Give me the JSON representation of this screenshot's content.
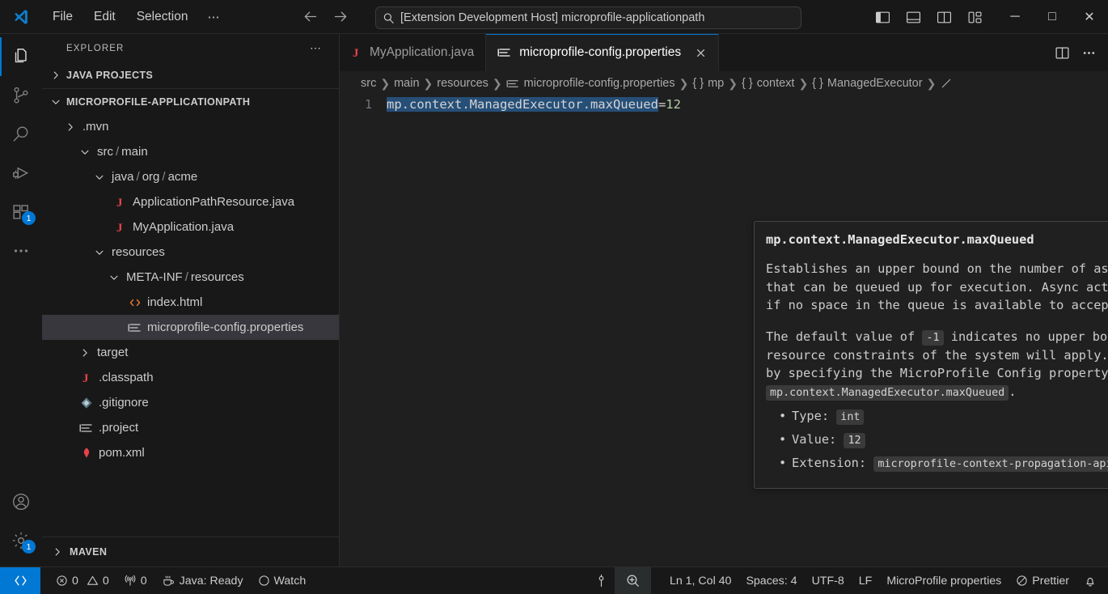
{
  "titlebar": {
    "menus": [
      "File",
      "Edit",
      "Selection",
      "⋯"
    ],
    "back_icon": "arrow-left-icon",
    "forward_icon": "arrow-right-icon",
    "command_center": {
      "icon": "search-icon",
      "text": "[Extension Development Host] microprofile-applicationpath"
    },
    "layout_buttons": [
      {
        "name": "toggle-primary-sidebar",
        "icon": "layout-sidebar-left-icon"
      },
      {
        "name": "toggle-panel",
        "icon": "layout-panel-icon"
      },
      {
        "name": "toggle-secondary-sidebar",
        "icon": "layout-sidebar-right-icon"
      },
      {
        "name": "customize-layout",
        "icon": "layout-customize-icon"
      }
    ],
    "window_buttons": [
      {
        "name": "minimize-button",
        "glyph": "─"
      },
      {
        "name": "maximize-button",
        "glyph": "□"
      },
      {
        "name": "close-button",
        "glyph": "✕"
      }
    ]
  },
  "activitybar": {
    "items": [
      {
        "name": "explorer",
        "icon": "files-icon",
        "active": true,
        "badge": ""
      },
      {
        "name": "source-control",
        "icon": "source-control-icon",
        "active": false,
        "badge": ""
      },
      {
        "name": "search",
        "icon": "search-icon",
        "active": false,
        "badge": ""
      },
      {
        "name": "run-and-debug",
        "icon": "debug-icon",
        "active": false,
        "badge": ""
      },
      {
        "name": "extensions",
        "icon": "extensions-icon",
        "active": false,
        "badge": "1"
      },
      {
        "name": "additional-views",
        "icon": "ellipsis-icon",
        "active": false,
        "badge": ""
      }
    ],
    "bottom_items": [
      {
        "name": "accounts",
        "icon": "account-icon",
        "badge": ""
      },
      {
        "name": "manage-settings",
        "icon": "gear-icon",
        "badge": "1"
      }
    ]
  },
  "sidebar": {
    "title": "EXPLORER",
    "more_actions": "⋯",
    "sections": [
      {
        "label": "JAVA PROJECTS",
        "expanded": false,
        "chevron": "chevron-right-icon"
      },
      {
        "label": "MICROPROFILE-APPLICATIONPATH",
        "expanded": true,
        "chevron": "chevron-down-icon"
      }
    ],
    "tree": [
      {
        "label": ".mvn",
        "indent": 1,
        "chevron": "chevron-right-icon",
        "icon": "",
        "selected": false
      },
      {
        "label": "src",
        "label2": "main",
        "indent": 1,
        "chevron": "chevron-down-icon",
        "icon": "",
        "selected": false
      },
      {
        "label": "java",
        "label2": "org",
        "label3": "acme",
        "indent": 2,
        "chevron": "chevron-down-icon",
        "icon": "",
        "selected": false
      },
      {
        "label": "ApplicationPathResource.java",
        "indent": 3,
        "chevron": "",
        "icon": "java-icon",
        "selected": false
      },
      {
        "label": "MyApplication.java",
        "indent": 3,
        "chevron": "",
        "icon": "java-icon",
        "selected": false
      },
      {
        "label": "resources",
        "indent": 2,
        "chevron": "chevron-down-icon",
        "icon": "",
        "selected": false
      },
      {
        "label": "META-INF",
        "label2": "resources",
        "indent": 3,
        "chevron": "chevron-down-icon",
        "icon": "",
        "selected": false
      },
      {
        "label": "index.html",
        "indent": 4,
        "chevron": "",
        "icon": "html-icon",
        "selected": false
      },
      {
        "label": "microprofile-config.properties",
        "indent": 4,
        "chevron": "",
        "icon": "properties-icon",
        "selected": true
      },
      {
        "label": "target",
        "indent": 1,
        "chevron": "chevron-right-icon",
        "icon": "",
        "selected": false
      },
      {
        "label": ".classpath",
        "indent": 1,
        "chevron": "",
        "icon": "java-icon",
        "selected": false
      },
      {
        "label": ".gitignore",
        "indent": 1,
        "chevron": "",
        "icon": "git-icon",
        "selected": false
      },
      {
        "label": ".project",
        "indent": 1,
        "chevron": "",
        "icon": "properties-icon",
        "selected": false
      },
      {
        "label": "pom.xml",
        "indent": 1,
        "chevron": "",
        "icon": "maven-icon",
        "selected": false
      }
    ],
    "bottom_section": {
      "label": "MAVEN",
      "chevron": "chevron-right-icon"
    }
  },
  "editor": {
    "tabs": [
      {
        "label": "MyApplication.java",
        "icon": "java-icon",
        "active": false,
        "closable": false
      },
      {
        "label": "microprofile-config.properties",
        "icon": "properties-icon",
        "active": true,
        "closable": true,
        "close_icon": "close-icon"
      }
    ],
    "tab_actions": [
      {
        "name": "split-editor-right",
        "icon": "split-editor-icon"
      },
      {
        "name": "editor-more-actions",
        "icon": "ellipsis-icon"
      }
    ],
    "breadcrumb": [
      {
        "label": "src",
        "icon": ""
      },
      {
        "label": "main",
        "icon": ""
      },
      {
        "label": "resources",
        "icon": ""
      },
      {
        "label": "microprofile-config.properties",
        "icon": "properties-icon"
      },
      {
        "label": "mp",
        "icon": "braces"
      },
      {
        "label": "context",
        "icon": "braces"
      },
      {
        "label": "ManagedExecutor",
        "icon": "braces"
      }
    ],
    "line_number": "1",
    "code": {
      "key": "mp.context.ManagedExecutor.maxQueued",
      "equals": "=",
      "value": "12"
    }
  },
  "hover": {
    "title": "mp.context.ManagedExecutor.maxQueued",
    "paragraph1": "Establishes an upper bound on the number of async actions and async tasks that can be queued up for execution. Async actions and tasks are rejected if no space in the queue is available to accept them.",
    "paragraph2_a": "The default value of",
    "paragraph2_code1": "-1",
    "paragraph2_b": "indicates no upper bound, although practically, resource constraints of the system will apply. You can switch the default by specifying the MicroProfile Config property,",
    "paragraph2_code2": "mp.context.ManagedExecutor.maxQueued",
    "paragraph2_c": ".",
    "items": [
      {
        "label": "Type:",
        "value": "int"
      },
      {
        "label": "Value:",
        "value": "12"
      },
      {
        "label": "Extension:",
        "value": "microprofile-context-propagation-api"
      }
    ]
  },
  "statusbar": {
    "remote_icon": "remote-indicator-icon",
    "left_items": [
      {
        "name": "problems-errors",
        "icon": "error-icon",
        "label": "0"
      },
      {
        "name": "problems-warnings",
        "icon": "warning-icon",
        "label": "0"
      },
      {
        "name": "ports",
        "icon": "radio-tower-icon",
        "label": "0"
      },
      {
        "name": "java-status",
        "icon": "coffee-icon",
        "label": "Java: Ready"
      },
      {
        "name": "watch-status",
        "icon": "circle-icon",
        "label": "Watch"
      }
    ],
    "mid_items": [
      {
        "name": "editor-actions",
        "icon": "pin-icon",
        "label": ""
      },
      {
        "name": "screencast-zoom",
        "icon": "zoom-in-icon",
        "label": "",
        "highlight": true
      }
    ],
    "right_items": [
      {
        "name": "cursor-position",
        "label": "Ln 1, Col 40"
      },
      {
        "name": "indentation",
        "label": "Spaces: 4"
      },
      {
        "name": "encoding",
        "label": "UTF-8"
      },
      {
        "name": "eol",
        "label": "LF"
      },
      {
        "name": "language-mode",
        "label": "MicroProfile properties"
      },
      {
        "name": "prettier-status",
        "icon": "prohibited-icon",
        "label": "Prettier"
      },
      {
        "name": "notifications",
        "icon": "bell-icon",
        "label": ""
      }
    ]
  },
  "colors": {
    "accent": "#0078d4",
    "sidebar_bg": "#181818",
    "editor_bg": "#1f1f1f",
    "selection_bg": "#37373d",
    "hover_bg": "#202020",
    "java_icon": "#e5424a",
    "html_icon": "#e37933",
    "value_green": "#b5cea8",
    "code_selection": "#264f78"
  }
}
